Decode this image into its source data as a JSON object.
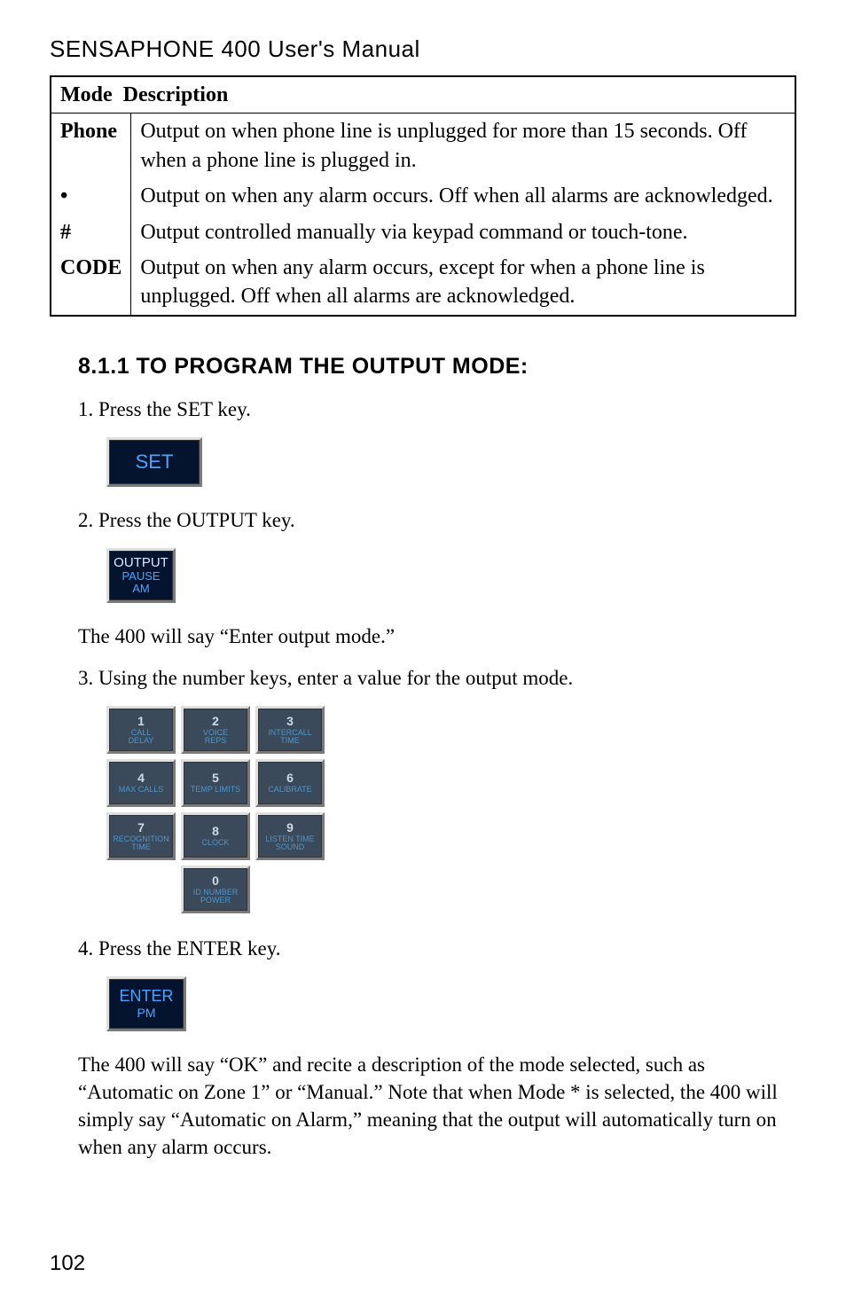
{
  "header": "SENSAPHONE 400 User's Manual",
  "table": {
    "head_mode": "Mode",
    "head_desc": "Description",
    "rows": [
      {
        "mode": "Phone",
        "desc": "Output on when phone line is unplugged for more than 15 seconds. Off when a phone line is plugged in."
      },
      {
        "mode": "•",
        "desc": "Output on when any alarm occurs. Off when all alarms are acknowledged."
      },
      {
        "mode": "#",
        "desc": "Output controlled manually via keypad command or touch-tone."
      },
      {
        "mode": "CODE",
        "desc": "Output on when any alarm occurs, except for when a phone line is unplugged. Off when all alarms are acknowledged."
      }
    ]
  },
  "section_heading": "8.1.1 TO PROGRAM THE OUTPUT MODE:",
  "step1": "1. Press the SET key.",
  "set_key": "SET",
  "step2": "2. Press the OUTPUT key.",
  "output_key": {
    "l1": "OUTPUT",
    "l2": "PAUSE",
    "l3": "AM"
  },
  "line_say_enter": "The 400 will say “Enter output mode.”",
  "step3": "3. Using the number keys, enter a value for the output mode.",
  "keypad": [
    [
      {
        "n": "1",
        "l": "CALL\nDELAY"
      },
      {
        "n": "2",
        "l": "VOICE\nREPS"
      },
      {
        "n": "3",
        "l": "INTERCALL\nTIME"
      }
    ],
    [
      {
        "n": "4",
        "l": "MAX CALLS"
      },
      {
        "n": "5",
        "l": "TEMP LIMITS"
      },
      {
        "n": "6",
        "l": "CALIBRATE"
      }
    ],
    [
      {
        "n": "7",
        "l": "RECOGNITION\nTIME"
      },
      {
        "n": "8",
        "l": "CLOCK"
      },
      {
        "n": "9",
        "l": "LISTEN TIME\nSOUND"
      }
    ],
    [
      {
        "n": "0",
        "l": "ID NUMBER\nPOWER"
      }
    ]
  ],
  "step4": "4. Press the ENTER key.",
  "enter_key": {
    "l1": "ENTER",
    "l2": "PM"
  },
  "closing": "The 400 will say “OK” and recite a description of the mode selected, such as “Automatic on Zone 1” or “Manual.” Note that when Mode * is selected, the 400 will simply say “Automatic on Alarm,” meaning that the output will automatically turn on when any alarm occurs.",
  "page_number": "102",
  "chart_data": null
}
